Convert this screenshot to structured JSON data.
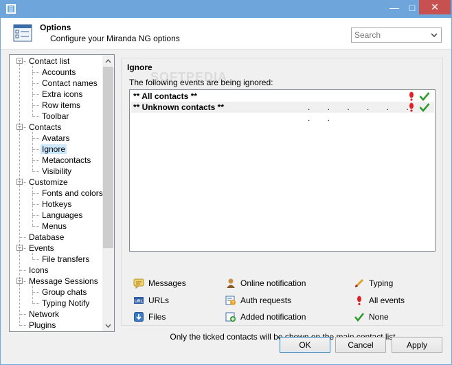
{
  "window": {
    "minimize": "—",
    "maximize": "□",
    "close": "✕"
  },
  "header": {
    "title": "Options",
    "subtitle": "Configure your Miranda NG options"
  },
  "search": {
    "placeholder": "Search",
    "value": ""
  },
  "tree": [
    {
      "label": "Contact list",
      "level": 0,
      "expander": "−"
    },
    {
      "label": "Accounts",
      "level": 1
    },
    {
      "label": "Contact names",
      "level": 1
    },
    {
      "label": "Extra icons",
      "level": 1
    },
    {
      "label": "Row items",
      "level": 1
    },
    {
      "label": "Toolbar",
      "level": 1
    },
    {
      "label": "Contacts",
      "level": 0,
      "expander": "−"
    },
    {
      "label": "Avatars",
      "level": 1
    },
    {
      "label": "Ignore",
      "level": 1,
      "selected": true
    },
    {
      "label": "Metacontacts",
      "level": 1
    },
    {
      "label": "Visibility",
      "level": 1
    },
    {
      "label": "Customize",
      "level": 0,
      "expander": "−"
    },
    {
      "label": "Fonts and colors",
      "level": 1
    },
    {
      "label": "Hotkeys",
      "level": 1
    },
    {
      "label": "Languages",
      "level": 1
    },
    {
      "label": "Menus",
      "level": 1
    },
    {
      "label": "Database",
      "level": 0
    },
    {
      "label": "Events",
      "level": 0,
      "expander": "−"
    },
    {
      "label": "File transfers",
      "level": 1
    },
    {
      "label": "Icons",
      "level": 0
    },
    {
      "label": "Message Sessions",
      "level": 0,
      "expander": "−"
    },
    {
      "label": "Group chats",
      "level": 1
    },
    {
      "label": "Typing Notify",
      "level": 1
    },
    {
      "label": "Network",
      "level": 0
    },
    {
      "label": "Plugins",
      "level": 0
    }
  ],
  "ignore": {
    "title": "Ignore",
    "description": "The following events are being ignored:",
    "rows": [
      {
        "label": "** All contacts **",
        "dots": ""
      },
      {
        "label": "** Unknown contacts **",
        "dots": ". . . . . . . ."
      }
    ],
    "legend": [
      {
        "icon": "messages-icon",
        "label": "Messages"
      },
      {
        "icon": "online-notification-icon",
        "label": "Online notification"
      },
      {
        "icon": "typing-icon",
        "label": "Typing"
      },
      {
        "icon": "urls-icon",
        "label": "URLs"
      },
      {
        "icon": "auth-requests-icon",
        "label": "Auth requests"
      },
      {
        "icon": "all-events-icon",
        "label": "All events"
      },
      {
        "icon": "files-icon",
        "label": "Files"
      },
      {
        "icon": "added-notification-icon",
        "label": "Added notification"
      },
      {
        "icon": "none-icon",
        "label": "None"
      }
    ],
    "note": "Only the ticked contacts will be shown on the main contact list"
  },
  "buttons": {
    "ok": "OK",
    "cancel": "Cancel",
    "apply": "Apply"
  },
  "colors": {
    "titlebar": "#6ea6dc",
    "close": "#c75050",
    "selected": "#cce8ff",
    "exclamation": "#e0202a",
    "check": "#2e9a2e"
  }
}
